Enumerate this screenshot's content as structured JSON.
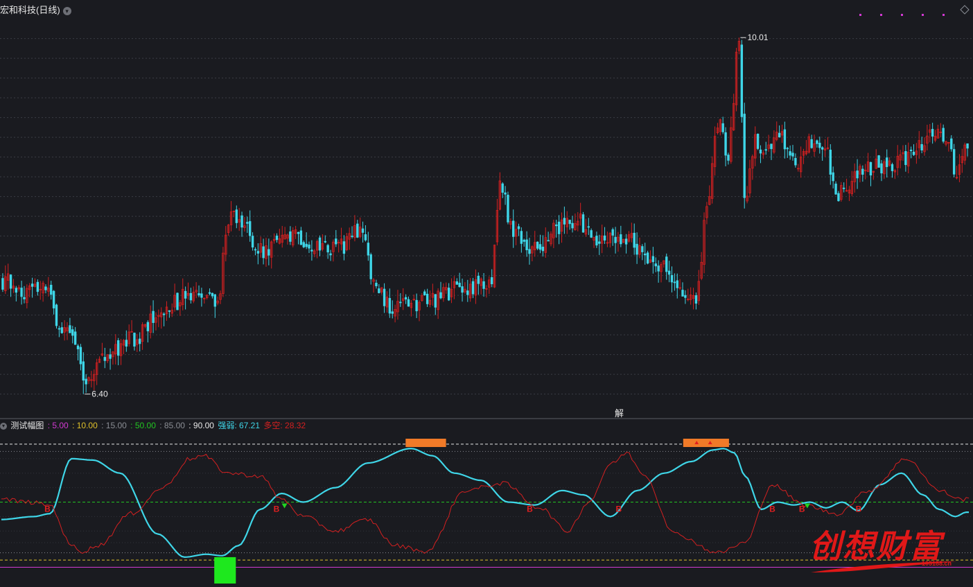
{
  "header": {
    "stock_title": "宏和科技(日线)",
    "dropdown_icon": "chevron-down-icon",
    "diamond_icon": "diamond-icon"
  },
  "annotations": {
    "high_label": "10.01",
    "low_label": "6.40",
    "jie_label": "解"
  },
  "indicator": {
    "name": "测试幅图",
    "levels": [
      {
        "text": ": 5.00",
        "color": "#d23ad2"
      },
      {
        "text": ": 10.00",
        "color": "#e0c12a"
      },
      {
        "text": ": 15.00",
        "color": "#8a8d94"
      },
      {
        "text": ": 50.00",
        "color": "#22c522"
      },
      {
        "text": ": 85.00",
        "color": "#8a8d94"
      },
      {
        "text": ": 90.00",
        "color": "#e8e8e8"
      }
    ],
    "strong_label": "强弱: 67.21",
    "strong_color": "#3fd6e8",
    "dk_label": "多空: 28.32",
    "dk_color": "#d42020",
    "b_marker": "B"
  },
  "watermark": {
    "text": "创想财富",
    "url": "105188.cn"
  },
  "chart_data": [
    {
      "type": "candlestick",
      "title": "宏和科技(日线)",
      "ylim": [
        6.25,
        10.25
      ],
      "y_gridlines": [
        10.0,
        9.8,
        9.6,
        9.4,
        9.2,
        9.0,
        8.8,
        8.6,
        8.4,
        8.2,
        8.0,
        7.8,
        7.6,
        7.4,
        7.2,
        7.0,
        6.8,
        6.6,
        6.4
      ],
      "annotated_high": 10.01,
      "annotated_low": 6.4,
      "up_color": "#d42020",
      "down_color": "#3fd6e8",
      "anchors_close": [
        [
          0,
          7.55
        ],
        [
          8,
          7.45
        ],
        [
          15,
          7.5
        ],
        [
          22,
          7.1
        ],
        [
          28,
          6.9
        ],
        [
          30,
          6.55
        ],
        [
          38,
          6.75
        ],
        [
          48,
          6.95
        ],
        [
          60,
          7.25
        ],
        [
          68,
          7.38
        ],
        [
          75,
          7.35
        ],
        [
          80,
          7.35
        ],
        [
          84,
          8.2
        ],
        [
          90,
          8.1
        ],
        [
          96,
          7.85
        ],
        [
          104,
          7.93
        ],
        [
          110,
          8.0
        ],
        [
          118,
          7.85
        ],
        [
          126,
          7.9
        ],
        [
          134,
          8.08
        ],
        [
          138,
          7.5
        ],
        [
          144,
          7.3
        ],
        [
          152,
          7.3
        ],
        [
          160,
          7.35
        ],
        [
          168,
          7.45
        ],
        [
          178,
          7.5
        ],
        [
          182,
          7.6
        ],
        [
          185,
          8.5
        ],
        [
          190,
          8.05
        ],
        [
          198,
          7.85
        ],
        [
          206,
          8.1
        ],
        [
          214,
          8.15
        ],
        [
          220,
          7.95
        ],
        [
          226,
          8.0
        ],
        [
          232,
          8.0
        ],
        [
          240,
          7.8
        ],
        [
          246,
          7.7
        ],
        [
          252,
          7.45
        ],
        [
          258,
          7.3
        ],
        [
          262,
          8.3
        ],
        [
          266,
          9.15
        ],
        [
          270,
          8.85
        ],
        [
          274,
          9.95
        ],
        [
          276,
          8.4
        ],
        [
          280,
          8.95
        ],
        [
          284,
          8.85
        ],
        [
          288,
          9.05
        ],
        [
          296,
          8.7
        ],
        [
          300,
          8.95
        ],
        [
          306,
          8.95
        ],
        [
          310,
          8.4
        ],
        [
          314,
          8.55
        ],
        [
          322,
          8.7
        ],
        [
          330,
          8.7
        ],
        [
          336,
          8.8
        ],
        [
          342,
          8.95
        ],
        [
          348,
          9.05
        ],
        [
          352,
          8.9
        ],
        [
          355,
          8.6
        ],
        [
          358,
          8.85
        ]
      ],
      "overlay_lines": {
        "magenta_dotted_y_px": 21
      }
    },
    {
      "type": "line",
      "title": "测试幅图",
      "ylim": [
        0,
        100
      ],
      "reference_levels": [
        {
          "value": 5,
          "color": "#d23ad2",
          "style": "solid"
        },
        {
          "value": 10,
          "color": "#e0c12a",
          "style": "dashed"
        },
        {
          "value": 15,
          "color": "#8a8d94",
          "style": "dotted"
        },
        {
          "value": 50,
          "color": "#22c522",
          "style": "dashed"
        },
        {
          "value": 85,
          "color": "#8a8d94",
          "style": "dotted"
        },
        {
          "value": 90,
          "color": "#e8e8e8",
          "style": "dashed"
        }
      ],
      "series": [
        {
          "name": "强弱",
          "color": "#3fd6e8",
          "last_value": 67.21,
          "anchors": [
            [
              0,
              38
            ],
            [
              12,
              40
            ],
            [
              18,
              42
            ],
            [
              26,
              80
            ],
            [
              34,
              79
            ],
            [
              44,
              70
            ],
            [
              58,
              28
            ],
            [
              68,
              12
            ],
            [
              76,
              14
            ],
            [
              82,
              13
            ],
            [
              88,
              20
            ],
            [
              96,
              45
            ],
            [
              104,
              56
            ],
            [
              112,
              50
            ],
            [
              124,
              60
            ],
            [
              136,
              77
            ],
            [
              152,
              87
            ],
            [
              160,
              82
            ],
            [
              168,
              70
            ],
            [
              178,
              65
            ],
            [
              188,
              50
            ],
            [
              198,
              48
            ],
            [
              208,
              58
            ],
            [
              216,
              55
            ],
            [
              226,
              40
            ],
            [
              236,
              58
            ],
            [
              246,
              70
            ],
            [
              256,
              78
            ],
            [
              264,
              86
            ],
            [
              268,
              87
            ],
            [
              272,
              84
            ],
            [
              276,
              68
            ],
            [
              282,
              45
            ],
            [
              288,
              50
            ],
            [
              294,
              48
            ],
            [
              300,
              50
            ],
            [
              306,
              46
            ],
            [
              312,
              50
            ],
            [
              318,
              44
            ],
            [
              326,
              62
            ],
            [
              334,
              70
            ],
            [
              342,
              55
            ],
            [
              348,
              45
            ],
            [
              354,
              40
            ],
            [
              358,
              43
            ]
          ]
        },
        {
          "name": "多空",
          "color": "#d42020",
          "last_value": 28.32,
          "anchors": [
            [
              0,
              52
            ],
            [
              10,
              50
            ],
            [
              18,
              48
            ],
            [
              26,
              20
            ],
            [
              30,
              16
            ],
            [
              36,
              20
            ],
            [
              48,
              42
            ],
            [
              60,
              60
            ],
            [
              70,
              80
            ],
            [
              75,
              82
            ],
            [
              84,
              70
            ],
            [
              96,
              68
            ],
            [
              104,
              52
            ],
            [
              112,
              40
            ],
            [
              124,
              30
            ],
            [
              136,
              38
            ],
            [
              146,
              20
            ],
            [
              158,
              16
            ],
            [
              172,
              58
            ],
            [
              186,
              63
            ],
            [
              200,
              46
            ],
            [
              210,
              30
            ],
            [
              218,
              50
            ],
            [
              226,
              76
            ],
            [
              232,
              84
            ],
            [
              238,
              70
            ],
            [
              250,
              28
            ],
            [
              266,
              15
            ],
            [
              276,
              22
            ],
            [
              286,
              62
            ],
            [
              298,
              48
            ],
            [
              310,
              42
            ],
            [
              322,
              58
            ],
            [
              336,
              80
            ],
            [
              348,
              58
            ],
            [
              356,
              52
            ]
          ]
        }
      ],
      "b_markers": [
        17,
        102,
        196,
        229,
        286,
        297,
        318
      ],
      "highlight_zones": [
        {
          "from": 79,
          "to": 87,
          "color": "#1ee81e",
          "position": "bottom"
        },
        {
          "from": 150,
          "to": 165,
          "color": "#f07a28",
          "position": "top"
        },
        {
          "from": 253,
          "to": 270,
          "color": "#f07a28",
          "position": "top"
        }
      ]
    }
  ]
}
